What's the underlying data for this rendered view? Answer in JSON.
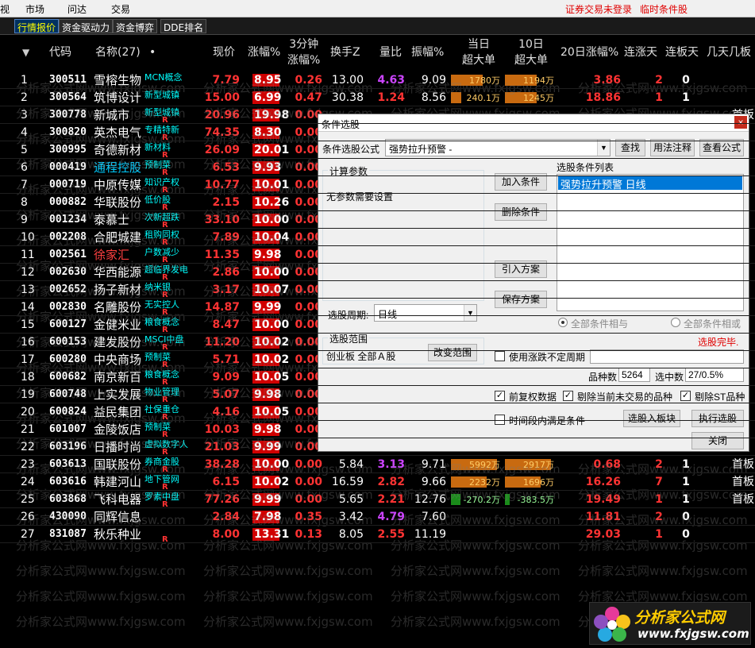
{
  "menu": {
    "items": [
      "视",
      "市场",
      "问达",
      "交易"
    ],
    "notice_login": "证券交易未登录",
    "notice_condition": "临时条件股"
  },
  "tabs": [
    "行情报价",
    "资金驱动力",
    "资金博弈",
    "DDE排名"
  ],
  "table": {
    "headers": {
      "sort": "▼",
      "code": "代码",
      "name": "名称(27)",
      "dot": "•",
      "price": "现价",
      "pct": "涨幅%",
      "min3": "3分钟\n涨幅%",
      "turnover": "换手Z",
      "volratio": "量比",
      "amplitude": "振幅%",
      "today_big": "当日\n超大单",
      "d10_big": "10日\n超大单",
      "d20": "20日涨幅%",
      "up_days": "连涨天",
      "limit_days": "连板天",
      "extra": "几天几板"
    },
    "rows": [
      {
        "idx": "1",
        "code": "300511",
        "name": "雪榕生物",
        "tag": "MCN概念",
        "r": "",
        "price": "7.79",
        "pct": "8.95",
        "min3": "0.26",
        "turn": "13.00",
        "ratio": "4.63",
        "ratio_color": "#cc44ff",
        "amp": "9.09",
        "today": "1780万",
        "today_w": 0.62,
        "d10": "1194万",
        "d10_w": 0.62,
        "d20": "3.86",
        "up": "2",
        "lb": "0",
        "ext": ""
      },
      {
        "idx": "2",
        "code": "300564",
        "name": "筑博设计",
        "tag": "新型城镇",
        "r": "",
        "price": "15.00",
        "pct": "6.99",
        "min3": "0.47",
        "turn": "30.38",
        "ratio": "1.24",
        "ratio_color": "#ff3333",
        "amp": "8.56",
        "today": "240.1万",
        "today_w": 0.2,
        "d10": "1245万",
        "d10_w": 0.62,
        "d20": "18.86",
        "up": "1",
        "lb": "1",
        "ext": ""
      },
      {
        "idx": "3",
        "code": "300778",
        "name": "新城市",
        "tag": "新型城镇",
        "r": "R",
        "price": "20.96",
        "pct": "19.98",
        "min3": "0.00",
        "turn": "",
        "ratio": "",
        "ratio_color": "#ff3333",
        "amp": "",
        "today": "",
        "today_w": 0.0,
        "d10": "",
        "d10_w": 0.0,
        "d20": "",
        "up": "",
        "lb": "",
        "ext": "首板"
      },
      {
        "idx": "4",
        "code": "300820",
        "name": "英杰电气",
        "tag": "专精特新",
        "r": "R",
        "price": "74.35",
        "pct": "8.30",
        "min3": "0.00",
        "turn": "",
        "ratio": "",
        "ratio_color": "#ff3333",
        "amp": "",
        "today": "",
        "today_w": 0.0,
        "d10": "",
        "d10_w": 0.0,
        "d20": "",
        "up": "",
        "lb": "",
        "ext": ""
      },
      {
        "idx": "5",
        "code": "300995",
        "name": "奇德新材",
        "tag": "新材料",
        "r": "R",
        "price": "26.09",
        "pct": "20.01",
        "min3": "0.00",
        "turn": "",
        "ratio": "",
        "ratio_color": "#ff3333",
        "amp": "",
        "today": "",
        "today_w": 0.0,
        "d10": "",
        "d10_w": 0.0,
        "d20": "",
        "up": "",
        "lb": "",
        "ext": ""
      },
      {
        "idx": "6",
        "code": "000419",
        "name": "通程控股",
        "tag": "预制菜",
        "r": "R",
        "price": "6.53",
        "pct": "9.93",
        "min3": "0.00",
        "turn": "",
        "ratio": "",
        "ratio_color": "#ff3333",
        "amp": "",
        "today": "",
        "today_w": 0.0,
        "d10": "",
        "d10_w": 0.0,
        "d20": "",
        "up": "",
        "lb": "",
        "ext": "",
        "hl": 1
      },
      {
        "idx": "7",
        "code": "000719",
        "name": "中原传媒",
        "tag": "知识产权",
        "r": "R",
        "price": "10.77",
        "pct": "10.01",
        "min3": "0.00",
        "turn": "",
        "ratio": "",
        "ratio_color": "#ff3333",
        "amp": "",
        "today": "",
        "today_w": 0.0,
        "d10": "",
        "d10_w": 0.0,
        "d20": "",
        "up": "",
        "lb": "",
        "ext": ""
      },
      {
        "idx": "8",
        "code": "000882",
        "name": "华联股份",
        "tag": "低价股",
        "r": "R",
        "price": "2.15",
        "pct": "10.26",
        "min3": "0.00",
        "turn": "",
        "ratio": "",
        "ratio_color": "#ff3333",
        "amp": "",
        "today": "",
        "today_w": 0.0,
        "d10": "",
        "d10_w": 0.0,
        "d20": "",
        "up": "",
        "lb": "",
        "ext": ""
      },
      {
        "idx": "9",
        "code": "001234",
        "name": "泰慕士",
        "tag": "次新超跌",
        "r": "R",
        "price": "33.10",
        "pct": "10.00",
        "min3": "0.00",
        "turn": "",
        "ratio": "",
        "ratio_color": "#ff3333",
        "amp": "",
        "today": "",
        "today_w": 0.0,
        "d10": "",
        "d10_w": 0.0,
        "d20": "",
        "up": "",
        "lb": "",
        "ext": ""
      },
      {
        "idx": "10",
        "code": "002208",
        "name": "合肥城建",
        "tag": "租购同权",
        "r": "R",
        "price": "7.89",
        "pct": "10.04",
        "min3": "0.00",
        "turn": "",
        "ratio": "",
        "ratio_color": "#ff3333",
        "amp": "",
        "today": "",
        "today_w": 0.0,
        "d10": "",
        "d10_w": 0.0,
        "d20": "",
        "up": "",
        "lb": "",
        "ext": ""
      },
      {
        "idx": "11",
        "code": "002561",
        "name": "徐家汇",
        "tag": "户数减少",
        "r": "R",
        "price": "11.35",
        "pct": "9.98",
        "min3": "0.00",
        "turn": "",
        "ratio": "",
        "ratio_color": "#ff3333",
        "amp": "",
        "today": "",
        "today_w": 0.0,
        "d10": "",
        "d10_w": 0.0,
        "d20": "",
        "up": "",
        "lb": "",
        "ext": "",
        "hl": 2
      },
      {
        "idx": "12",
        "code": "002630",
        "name": "华西能源",
        "tag": "超临界发电",
        "r": "R",
        "price": "2.86",
        "pct": "10.00",
        "min3": "0.00",
        "turn": "",
        "ratio": "",
        "ratio_color": "#ff3333",
        "amp": "",
        "today": "",
        "today_w": 0.0,
        "d10": "",
        "d10_w": 0.0,
        "d20": "",
        "up": "",
        "lb": "",
        "ext": ""
      },
      {
        "idx": "13",
        "code": "002652",
        "name": "扬子新材",
        "tag": "纳米银",
        "r": "R",
        "price": "3.17",
        "pct": "10.07",
        "min3": "0.00",
        "turn": "",
        "ratio": "",
        "ratio_color": "#ff3333",
        "amp": "",
        "today": "",
        "today_w": 0.0,
        "d10": "",
        "d10_w": 0.0,
        "d20": "",
        "up": "",
        "lb": "",
        "ext": ""
      },
      {
        "idx": "14",
        "code": "002830",
        "name": "名雕股份",
        "tag": "无实控人",
        "r": "R",
        "price": "14.87",
        "pct": "9.99",
        "min3": "0.00",
        "turn": "",
        "ratio": "",
        "ratio_color": "#ff3333",
        "amp": "",
        "today": "",
        "today_w": 0.0,
        "d10": "",
        "d10_w": 0.0,
        "d20": "",
        "up": "",
        "lb": "",
        "ext": ""
      },
      {
        "idx": "15",
        "code": "600127",
        "name": "金健米业",
        "tag": "粮食概念",
        "r": "R",
        "price": "8.47",
        "pct": "10.00",
        "min3": "0.00",
        "turn": "",
        "ratio": "",
        "ratio_color": "#ff3333",
        "amp": "",
        "today": "",
        "today_w": 0.0,
        "d10": "",
        "d10_w": 0.0,
        "d20": "",
        "up": "",
        "lb": "",
        "ext": ""
      },
      {
        "idx": "16",
        "code": "600153",
        "name": "建发股份",
        "tag": "MSCI中盘",
        "r": "R",
        "price": "11.20",
        "pct": "10.02",
        "min3": "0.00",
        "turn": "",
        "ratio": "",
        "ratio_color": "#ff3333",
        "amp": "",
        "today": "",
        "today_w": 0.0,
        "d10": "",
        "d10_w": 0.0,
        "d20": "",
        "up": "",
        "lb": "",
        "ext": ""
      },
      {
        "idx": "17",
        "code": "600280",
        "name": "中央商场",
        "tag": "预制菜",
        "r": "R",
        "price": "5.71",
        "pct": "10.02",
        "min3": "0.00",
        "turn": "",
        "ratio": "",
        "ratio_color": "#ff3333",
        "amp": "",
        "today": "",
        "today_w": 0.0,
        "d10": "",
        "d10_w": 0.0,
        "d20": "",
        "up": "",
        "lb": "",
        "ext": ""
      },
      {
        "idx": "18",
        "code": "600682",
        "name": "南京新百",
        "tag": "粮食概念",
        "r": "R",
        "price": "9.09",
        "pct": "10.05",
        "min3": "0.00",
        "turn": "",
        "ratio": "",
        "ratio_color": "#ff3333",
        "amp": "",
        "today": "",
        "today_w": 0.0,
        "d10": "",
        "d10_w": 0.0,
        "d20": "",
        "up": "",
        "lb": "",
        "ext": ""
      },
      {
        "idx": "19",
        "code": "600748",
        "name": "上实发展",
        "tag": "物业管理",
        "r": "R",
        "price": "5.07",
        "pct": "9.98",
        "min3": "0.00",
        "turn": "",
        "ratio": "",
        "ratio_color": "#ff3333",
        "amp": "",
        "today": "",
        "today_w": 0.0,
        "d10": "",
        "d10_w": 0.0,
        "d20": "",
        "up": "",
        "lb": "",
        "ext": ""
      },
      {
        "idx": "20",
        "code": "600824",
        "name": "益民集团",
        "tag": "社保重仓",
        "r": "R",
        "price": "4.16",
        "pct": "10.05",
        "min3": "0.00",
        "turn": "",
        "ratio": "",
        "ratio_color": "#ff3333",
        "amp": "",
        "today": "",
        "today_w": 0.0,
        "d10": "",
        "d10_w": 0.0,
        "d20": "",
        "up": "",
        "lb": "",
        "ext": ""
      },
      {
        "idx": "21",
        "code": "601007",
        "name": "金陵饭店",
        "tag": "预制菜",
        "r": "R",
        "price": "10.03",
        "pct": "9.98",
        "min3": "0.00",
        "turn": "",
        "ratio": "",
        "ratio_color": "#ff3333",
        "amp": "",
        "today": "",
        "today_w": 0.0,
        "d10": "",
        "d10_w": 0.0,
        "d20": "",
        "up": "",
        "lb": "",
        "ext": ""
      },
      {
        "idx": "22",
        "code": "603196",
        "name": "日播时尚",
        "tag": "虚拟数字人",
        "r": "R",
        "price": "21.03",
        "pct": "9.99",
        "min3": "0.00",
        "turn": "",
        "ratio": "",
        "ratio_color": "#ff3333",
        "amp": "",
        "today": "",
        "today_w": 0.0,
        "d10": "",
        "d10_w": 0.0,
        "d20": "",
        "up": "",
        "lb": "",
        "ext": ""
      },
      {
        "idx": "23",
        "code": "603613",
        "name": "国联股份",
        "tag": "券商金股",
        "r": "R",
        "price": "38.28",
        "pct": "10.00",
        "min3": "0.00",
        "turn": "5.84",
        "ratio": "3.13",
        "ratio_color": "#cc44ff",
        "amp": "9.71",
        "today": "5992万",
        "today_w": 0.9,
        "d10": "2917万",
        "d10_w": 0.9,
        "d20": "0.68",
        "up": "2",
        "lb": "1",
        "ext": "首板"
      },
      {
        "idx": "24",
        "code": "603616",
        "name": "韩建河山",
        "tag": "地下管网",
        "r": "R",
        "price": "6.15",
        "pct": "10.02",
        "min3": "0.00",
        "turn": "16.59",
        "ratio": "2.82",
        "ratio_color": "#ff3333",
        "amp": "9.66",
        "today": "2232万",
        "today_w": 0.7,
        "d10": "1696万",
        "d10_w": 0.7,
        "d20": "16.26",
        "up": "7",
        "lb": "1",
        "ext": "首板"
      },
      {
        "idx": "25",
        "code": "603868",
        "name": "飞科电器",
        "tag": "罗素中盘",
        "r": "R",
        "price": "77.26",
        "pct": "9.99",
        "min3": "0.00",
        "turn": "5.65",
        "ratio": "2.21",
        "ratio_color": "#ff3333",
        "amp": "12.76",
        "today": "-270.2万",
        "today_w": 0.18,
        "d10": "-383.5万",
        "d10_w": 0.1,
        "d20": "19.49",
        "up": "1",
        "lb": "1",
        "ext": "首板",
        "neg": true
      },
      {
        "idx": "26",
        "code": "430090",
        "name": "同辉信息",
        "tag": "",
        "r": "",
        "price": "2.84",
        "pct": "7.98",
        "min3": "0.35",
        "turn": "3.42",
        "ratio": "4.79",
        "ratio_color": "#cc44ff",
        "amp": "7.60",
        "today": "",
        "today_w": 0.0,
        "d10": "",
        "d10_w": 0.0,
        "d20": "11.81",
        "up": "2",
        "lb": "0",
        "ext": ""
      },
      {
        "idx": "27",
        "code": "831087",
        "name": "秋乐种业",
        "tag": "",
        "r": "R",
        "price": "8.00",
        "pct": "13.31",
        "min3": "0.13",
        "turn": "8.05",
        "ratio": "2.55",
        "ratio_color": "#ff3333",
        "amp": "11.19",
        "today": "",
        "today_w": 0.0,
        "d10": "",
        "d10_w": 0.0,
        "d20": "29.03",
        "up": "1",
        "lb": "0",
        "ext": ""
      }
    ]
  },
  "watermark": "分析家公式网www.fxjgsw.com",
  "logo": {
    "title": "分析家公式网",
    "url": "www.fxjgsw.com"
  },
  "dialog": {
    "title": "条件选股",
    "close": "×",
    "formula_label": "条件选股公式",
    "formula_value": "强势拉升预警 -",
    "btn_find": "查找",
    "btn_usage": "用法注释",
    "btn_view": "查看公式",
    "calc_group": "计算参数",
    "no_params": "无参数需要设置",
    "btn_add": "加入条件",
    "btn_delete": "删除条件",
    "btn_import": "引入方案",
    "btn_save": "保存方案",
    "cond_list_title": "选股条件列表",
    "cond_list_item": "强势拉升预警  日线",
    "period_label": "选股周期:",
    "period_value": "日线",
    "radio_and": "全部条件相与",
    "radio_or": "全部条件相或",
    "status_done": "选股完毕.",
    "range_group": "选股范围",
    "range_value": "创业板 全部Ａ股",
    "btn_change_range": "改变范围",
    "chk_uncertain": "使用涨跌不定周期",
    "stock_count_label": "品种数",
    "stock_count": "5264",
    "selected_label": "选中数",
    "selected": "27/0.5%",
    "chk_fq": "前复权数据",
    "chk_exclude_untraded": "剔除当前未交易的品种",
    "chk_exclude_st": "剔除ST品种",
    "chk_period_satisfy": "时间段内满足条件",
    "btn_to_block": "选股入板块",
    "btn_execute": "执行选股",
    "btn_close": "关闭"
  }
}
